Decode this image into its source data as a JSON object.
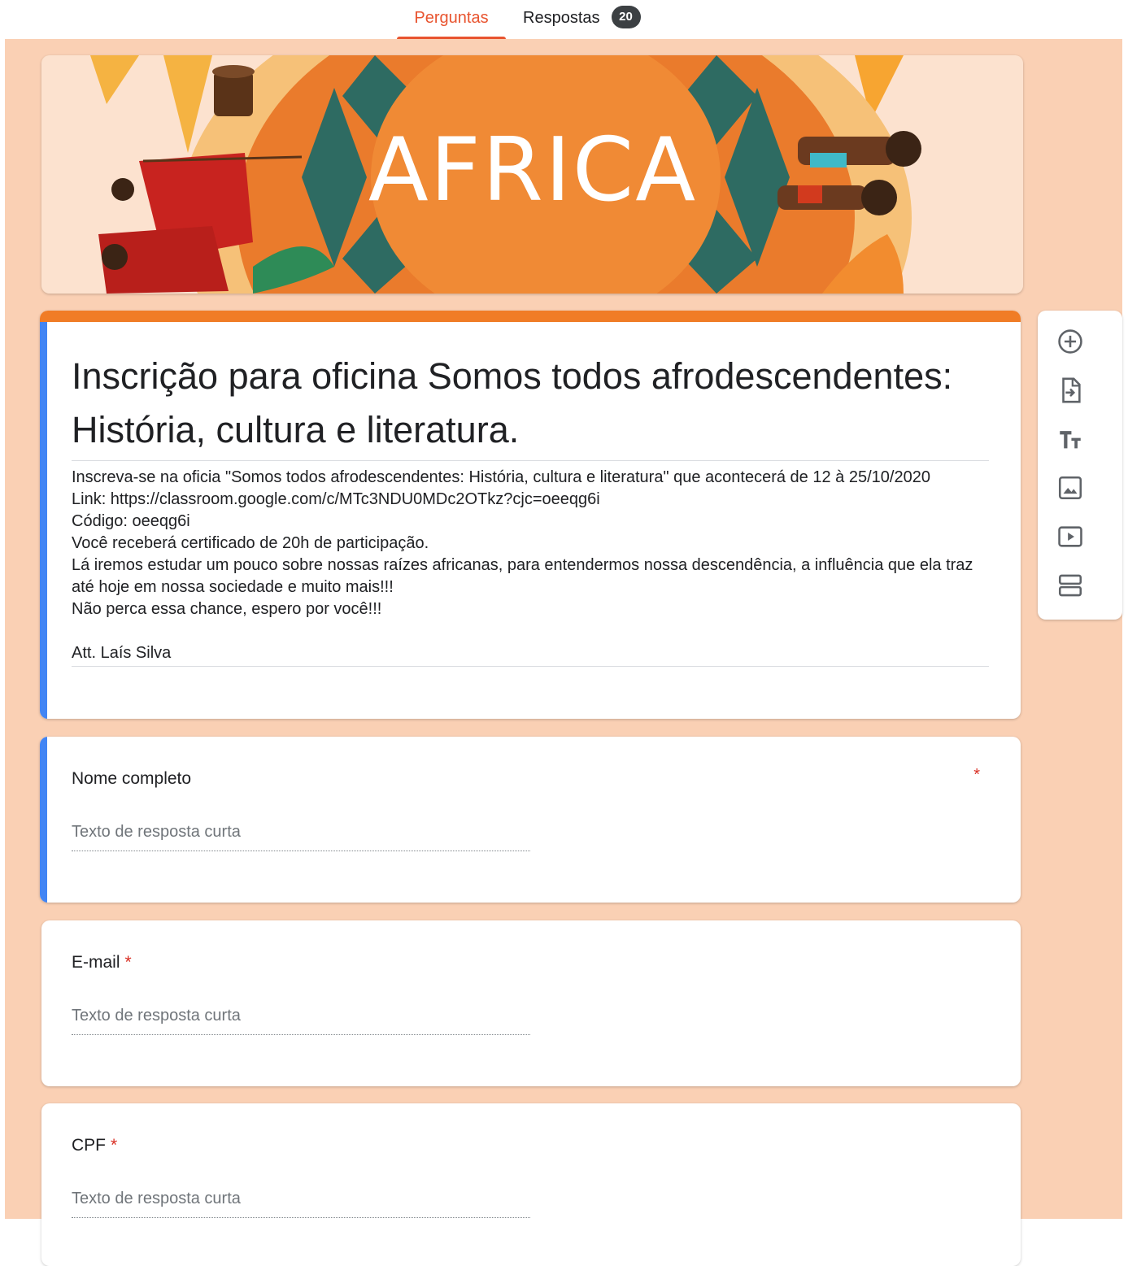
{
  "tabs": {
    "questions_label": "Perguntas",
    "responses_label": "Respostas",
    "responses_count": "20"
  },
  "header": {
    "banner_text": "AFRICA"
  },
  "form": {
    "title": "Inscrição para oficina Somos todos afrodescendentes: História, cultura e literatura.",
    "description": "Inscreva-se na oficia \"Somos todos afrodescendentes: História, cultura e literatura\" que acontecerá de 12 à 25/10/2020\nLink: https://classroom.google.com/c/MTc3NDU0MDc2OTkz?cjc=oeeqg6i\nCódigo: oeeqg6i\nVocê receberá certificado de 20h de participação.\nLá iremos estudar um pouco sobre nossas raízes africanas, para entendermos nossa descendência, a influência que ela traz até hoje em nossa sociedade e muito mais!!!\nNão perca essa chance, espero por você!!!\n\nAtt. Laís Silva"
  },
  "questions": [
    {
      "title": "Nome completo",
      "required_mark": "*",
      "placeholder": "Texto de resposta curta"
    },
    {
      "title": "E-mail",
      "required_mark": "*",
      "placeholder": "Texto de resposta curta"
    },
    {
      "title": "CPF",
      "required_mark": "*",
      "placeholder": "Texto de resposta curta"
    }
  ],
  "toolbar": {
    "icons": [
      "add-question-icon",
      "import-questions-icon",
      "add-title-icon",
      "add-image-icon",
      "add-video-icon",
      "add-section-icon"
    ]
  },
  "colors": {
    "accent": "#e8542f",
    "theme_strip": "#f07c26",
    "background": "#fad0b4",
    "active_bar": "#4285f4",
    "required": "#d93025"
  }
}
